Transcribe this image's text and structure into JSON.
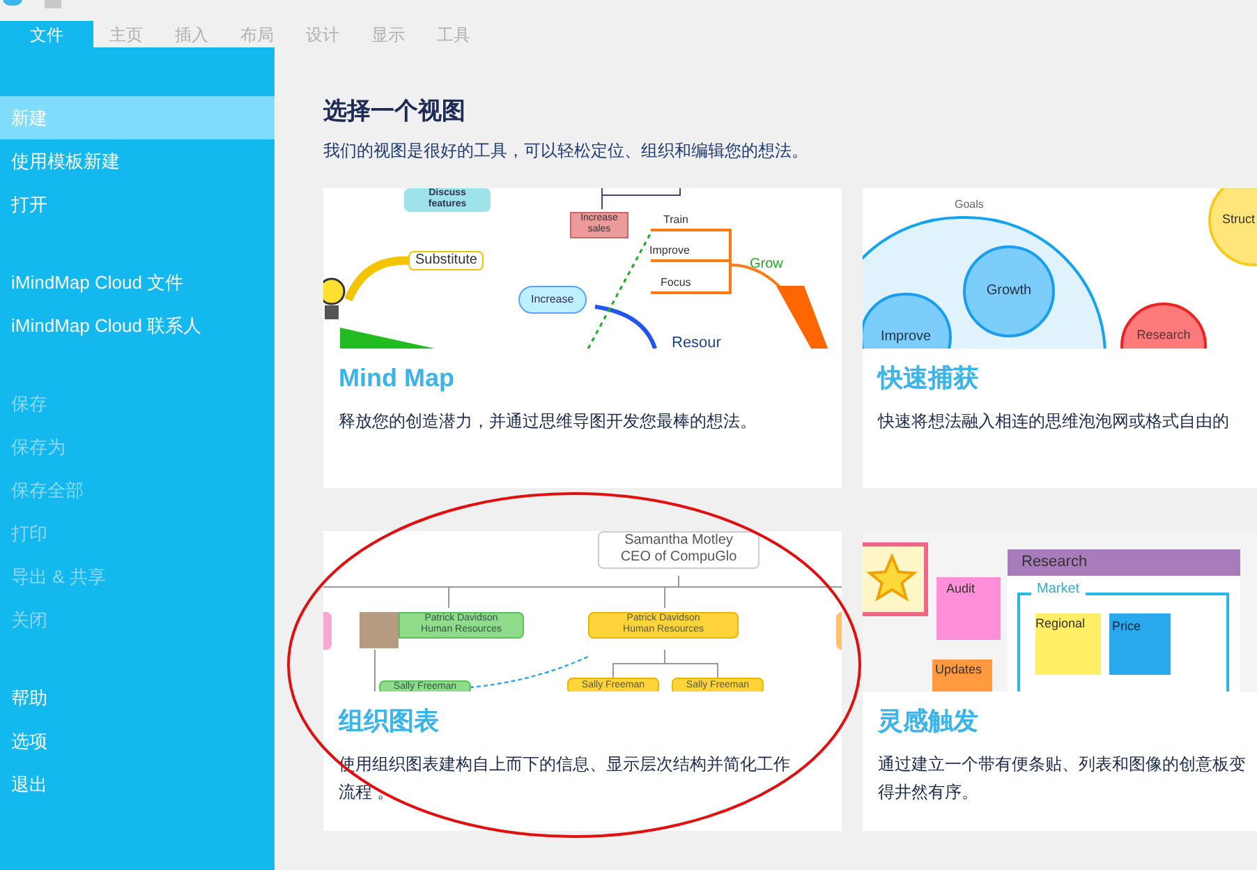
{
  "ribbon_tabs": [
    {
      "label": "文件",
      "selected": true
    },
    {
      "label": "主页",
      "selected": false
    },
    {
      "label": "插入",
      "selected": false
    },
    {
      "label": "布局",
      "selected": false
    },
    {
      "label": "设计",
      "selected": false
    },
    {
      "label": "显示",
      "selected": false
    },
    {
      "label": "工具",
      "selected": false
    }
  ],
  "sidebar": {
    "groups": [
      {
        "items": [
          {
            "label": "新建",
            "selected": true,
            "disabled": false
          },
          {
            "label": "使用模板新建",
            "selected": false,
            "disabled": false
          },
          {
            "label": "打开",
            "selected": false,
            "disabled": false
          }
        ]
      },
      {
        "items": [
          {
            "label": "iMindMap Cloud 文件",
            "selected": false,
            "disabled": false
          },
          {
            "label": "iMindMap Cloud 联系人",
            "selected": false,
            "disabled": false
          }
        ]
      },
      {
        "items": [
          {
            "label": "保存",
            "selected": false,
            "disabled": true
          },
          {
            "label": "保存为",
            "selected": false,
            "disabled": true
          },
          {
            "label": "保存全部",
            "selected": false,
            "disabled": true
          },
          {
            "label": "打印",
            "selected": false,
            "disabled": true
          },
          {
            "label": "导出 & 共享",
            "selected": false,
            "disabled": true
          },
          {
            "label": "关闭",
            "selected": false,
            "disabled": true
          }
        ]
      },
      {
        "items": [
          {
            "label": "帮助",
            "selected": false,
            "disabled": false
          },
          {
            "label": "选项",
            "selected": false,
            "disabled": false
          },
          {
            "label": "退出",
            "selected": false,
            "disabled": false
          }
        ]
      }
    ]
  },
  "main": {
    "title": "选择一个视图",
    "subtitle": "我们的视图是很好的工具，可以轻松定位、组织和编辑您的想法。",
    "views": [
      {
        "kind": "mindmap",
        "title": "Mind Map",
        "description": "释放您的创造潜力，并通过思维导图开发您最棒的想法。",
        "thumbnail_labels": [
          "Discuss\nfeatures",
          "Increase\nsales",
          "Train",
          "Improve",
          "Focus",
          "Grow",
          "Substitute",
          "Increase",
          "Resour"
        ]
      },
      {
        "kind": "bubble",
        "title": "快速捕获",
        "description": "快速将想法融入相连的思维泡泡网或格式自由的",
        "thumbnail_labels": [
          "Goals",
          "Growth",
          "Improve",
          "Struct",
          "Research"
        ]
      },
      {
        "kind": "orgchart",
        "title": "组织图表",
        "description": "使用组织图表建构自上而下的信息、显示层次结构并简化工作流程 。",
        "thumbnail_labels": [
          "Samantha Motley\nCEO of CompuGlo",
          "Patrick Davidson\nHuman Resources",
          "Patrick Davidson\nHuman Resources",
          "Sally Freeman",
          "Sally Freeman",
          "Sally Freeman"
        ]
      },
      {
        "kind": "board",
        "title": "灵感触发",
        "description": "通过建立一个带有便条贴、列表和图像的创意板变得井然有序。",
        "thumbnail_labels": [
          "Audit",
          "Updates",
          "Research",
          "Market",
          "Regional",
          "Price"
        ]
      }
    ]
  }
}
